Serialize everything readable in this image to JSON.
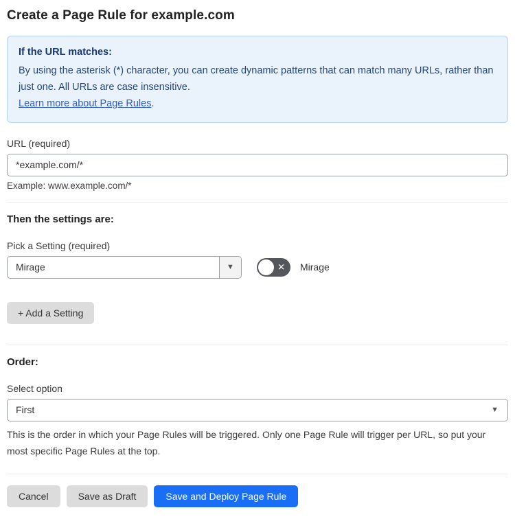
{
  "page": {
    "title": "Create a Page Rule for example.com"
  },
  "info_box": {
    "heading": "If the URL matches:",
    "body": "By using the asterisk (*) character, you can create dynamic patterns that can match many URLs, rather than just one. All URLs are case insensitive.",
    "link_label": "Learn more about Page Rules",
    "link_suffix": "."
  },
  "url_field": {
    "label": "URL (required)",
    "value": "*example.com/*",
    "helper": "Example: www.example.com/*"
  },
  "settings_section": {
    "heading": "Then the settings are:",
    "picker_label": "Pick a Setting (required)",
    "picker_value": "Mirage",
    "toggle_state": "off",
    "toggle_label": "Mirage",
    "add_setting_label": "+ Add a Setting"
  },
  "order_section": {
    "heading": "Order:",
    "select_label": "Select option",
    "select_value": "First",
    "helper": "This is the order in which your Page Rules will be triggered. Only one Page Rule will trigger per URL, so put your most specific Page Rules at the top."
  },
  "actions": {
    "cancel": "Cancel",
    "save_draft": "Save as Draft",
    "save_deploy": "Save and Deploy Page Rule"
  },
  "icons": {
    "dropdown_caret": "▼",
    "toggle_x": "✕"
  },
  "colors": {
    "primary_blue": "#1a6ef5",
    "info_bg": "#eaf2fc",
    "info_border": "#b5d3f3",
    "info_text": "#24477c",
    "link_blue": "#2f5bd6",
    "toggle_off": "#54565b",
    "button_gray": "#dcdcdc"
  }
}
